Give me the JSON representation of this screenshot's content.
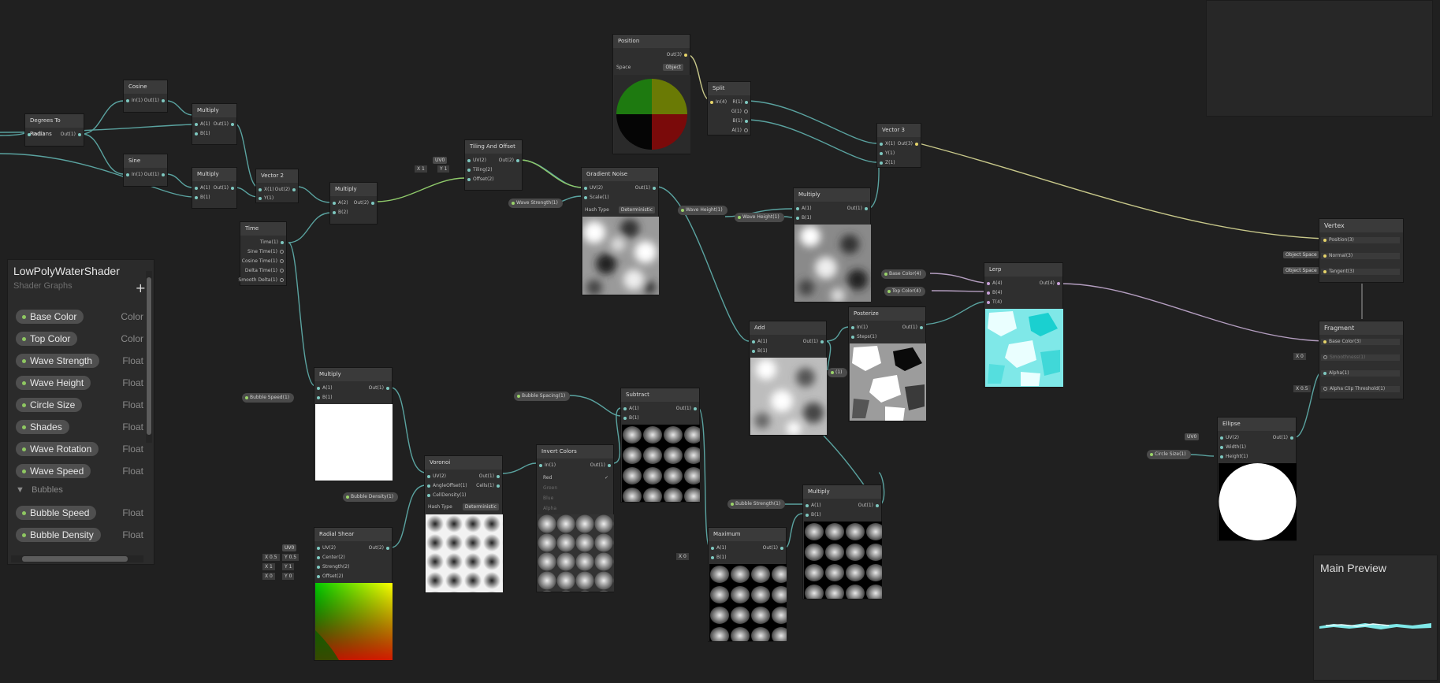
{
  "blackboard": {
    "title": "LowPolyWaterShader",
    "subtitle": "Shader Graphs",
    "add_label": "+",
    "properties": [
      {
        "name": "Base Color",
        "type": "Color"
      },
      {
        "name": "Top Color",
        "type": "Color"
      },
      {
        "name": "Wave Strength",
        "type": "Float"
      },
      {
        "name": "Wave Height",
        "type": "Float"
      },
      {
        "name": "Circle Size",
        "type": "Float"
      },
      {
        "name": "Shades",
        "type": "Float"
      },
      {
        "name": "Wave Rotation",
        "type": "Float"
      },
      {
        "name": "Wave Speed",
        "type": "Float"
      }
    ],
    "category": "Bubbles",
    "category_props": [
      {
        "name": "Bubble Speed",
        "type": "Float"
      },
      {
        "name": "Bubble Density",
        "type": "Float"
      }
    ]
  },
  "nodes": {
    "degrees_to_radians": {
      "title": "Degrees To Radians",
      "in": "In(1)",
      "out": "Out(1)"
    },
    "cosine": {
      "title": "Cosine",
      "in": "In(1)",
      "out": "Out(1)"
    },
    "sine": {
      "title": "Sine",
      "in": "In(1)",
      "out": "Out(1)"
    },
    "multiply_a": {
      "title": "Multiply",
      "a": "A(1)",
      "b": "B(1)",
      "out": "Out(1)"
    },
    "multiply_b": {
      "title": "Multiply",
      "a": "A(1)",
      "b": "B(1)",
      "out": "Out(1)"
    },
    "vector2": {
      "title": "Vector 2",
      "x": "X(1)",
      "y": "Y(1)",
      "out": "Out(2)"
    },
    "multiply_c": {
      "title": "Multiply",
      "a": "A(2)",
      "b": "B(2)",
      "out": "Out(2)"
    },
    "time": {
      "title": "Time",
      "outs": [
        "Time(1)",
        "Sine Time(1)",
        "Cosine Time(1)",
        "Delta Time(1)",
        "Smooth Delta(1)"
      ]
    },
    "tiling_offset": {
      "title": "Tiling And Offset",
      "uv": "UV(2)",
      "tiling": "Tiling(2)",
      "offset": "Offset(2)",
      "out": "Out(2)",
      "uv_dd": "UV0",
      "tiling_x": "X 1",
      "tiling_y": "Y 1"
    },
    "position": {
      "title": "Position",
      "out": "Out(3)",
      "space_label": "Space",
      "space_value": "Object"
    },
    "split": {
      "title": "Split",
      "in": "In(4)",
      "outs": [
        "R(1)",
        "G(1)",
        "B(1)",
        "A(1)"
      ]
    },
    "vector3": {
      "title": "Vector 3",
      "x": "X(1)",
      "y": "Y(1)",
      "z": "Z(1)",
      "out": "Out(3)"
    },
    "gradient_noise": {
      "title": "Gradient Noise",
      "uv": "UV(2)",
      "scale": "Scale(1)",
      "out": "Out(1)",
      "hash_label": "Hash Type",
      "hash_value": "Deterministic"
    },
    "multiply_d": {
      "title": "Multiply",
      "a": "A(1)",
      "b": "B(1)",
      "out": "Out(1)"
    },
    "add": {
      "title": "Add",
      "a": "A(1)",
      "b": "B(1)",
      "out": "Out(1)"
    },
    "posterize": {
      "title": "Posterize",
      "in": "In(1)",
      "steps": "Steps(1)",
      "out": "Out(1)"
    },
    "lerp": {
      "title": "Lerp",
      "a": "A(4)",
      "b": "B(4)",
      "t": "T(4)",
      "out": "Out(4)"
    },
    "vertex": {
      "title": "Vertex",
      "position": "Position(3)",
      "normal": "Normal(3)",
      "tangent": "Tangent(3)",
      "normal_space": "Object Space",
      "tangent_space": "Object Space"
    },
    "fragment": {
      "title": "Fragment",
      "base_color": "Base Color(3)",
      "smoothness": "Smoothness(1)",
      "alpha": "Alpha(1)",
      "clip": "Alpha Clip Threshold(1)",
      "smooth_val": "X  0",
      "clip_val": "X  0.5"
    },
    "ellipse": {
      "title": "Ellipse",
      "uv": "UV(2)",
      "width": "Width(1)",
      "height": "Height(1)",
      "out": "Out(1)",
      "uv_dd": "UV0"
    },
    "multiply_e": {
      "title": "Multiply",
      "a": "A(1)",
      "b": "B(1)",
      "out": "Out(1)"
    },
    "radial_shear": {
      "title": "Radial Shear",
      "uv": "UV(2)",
      "center": "Center(2)",
      "strength": "Strength(2)",
      "offset": "Offset(2)",
      "out": "Out(2)",
      "uv_dd": "UV0",
      "center_x": "X 0.5",
      "center_y": "Y 0.5",
      "strength_x": "X 1",
      "strength_y": "Y 1",
      "offset_x": "X 0",
      "offset_y": "Y 0"
    },
    "voronoi": {
      "title": "Voronoi",
      "uv": "UV(2)",
      "angle": "AngleOffset(1)",
      "density": "CellDensity(1)",
      "out": "Out(1)",
      "cells": "Cells(1)",
      "hash_label": "Hash Type",
      "hash_value": "Deterministic"
    },
    "invert": {
      "title": "Invert Colors",
      "in": "In(1)",
      "out": "Out(1)",
      "channels": [
        "Red",
        "Green",
        "Blue",
        "Alpha"
      ]
    },
    "subtract": {
      "title": "Subtract",
      "a": "A(1)",
      "b": "B(1)",
      "out": "Out(1)"
    },
    "maximum": {
      "title": "Maximum",
      "a": "A(1)",
      "b": "B(1)",
      "out": "Out(1)",
      "b_val": "X  0"
    },
    "multiply_f": {
      "title": "Multiply",
      "a": "A(1)",
      "b": "B(1)",
      "out": "Out(1)"
    }
  },
  "pills": {
    "wave_strength": "Wave Strength(1)",
    "wave_height_a": "Wave Height(1)",
    "wave_height_b": "Wave Height(1)",
    "base_color": "Base Color(4)",
    "top_color": "Top Color(4)",
    "bubble_speed": "Bubble Speed(1)",
    "bubble_density": "Bubble Density(1)",
    "bubble_spacing": "Bubble Spacing(1)",
    "bubble_strength": "Bubble Strength(1)",
    "circle_size": "Circle Size(1)",
    "shades": "(1)"
  },
  "main_preview": {
    "title": "Main Preview"
  }
}
